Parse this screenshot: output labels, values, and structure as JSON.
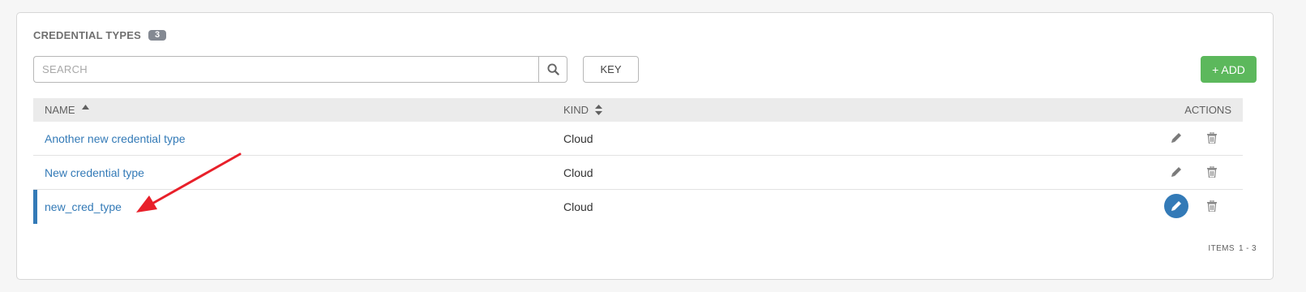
{
  "panel": {
    "title": "CREDENTIAL TYPES",
    "count": "3"
  },
  "search": {
    "placeholder": "SEARCH",
    "value": "",
    "icon": "search-icon"
  },
  "toolbar": {
    "key_label": "KEY",
    "add_label": "+ ADD"
  },
  "table": {
    "columns": [
      {
        "label": "NAME",
        "sort": "ascending"
      },
      {
        "label": "KIND",
        "sort": "sortable"
      },
      {
        "label": "ACTIONS"
      }
    ],
    "rows": [
      {
        "name": "Another new credential type",
        "kind": "Cloud"
      },
      {
        "name": "New credential type",
        "kind": "Cloud"
      },
      {
        "name": "new_cred_type",
        "kind": "Cloud",
        "selected": true
      }
    ]
  },
  "footer": {
    "items_label": "ITEMS",
    "items_range": "1 - 3"
  },
  "colors": {
    "link": "#337ab7",
    "add_button": "#5cb85c",
    "annotation_arrow": "#e8202a",
    "selected_indicator": "#337ab7"
  },
  "icons": {
    "edit": "pencil-icon",
    "delete": "trash-icon",
    "sort_asc": "sort-up-icon",
    "sort_both": "sort-icon"
  }
}
